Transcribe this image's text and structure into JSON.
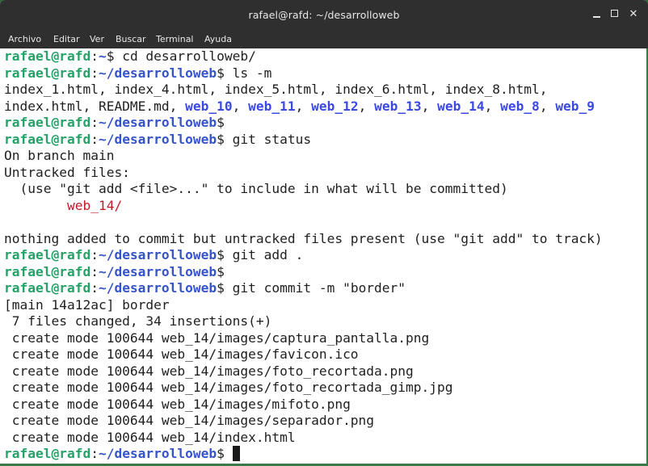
{
  "window": {
    "title": "rafael@rafd: ~/desarrolloweb",
    "controls": {
      "minimize": "minimize-icon",
      "maximize": "maximize-icon",
      "close": "close-icon"
    }
  },
  "menu": [
    "Archivo",
    "Editar",
    "Ver",
    "Buscar",
    "Terminal",
    "Ayuda"
  ],
  "colors": {
    "prompt_user": "#26a269",
    "prompt_path": "#3654c9",
    "directory": "#3b49e0",
    "untracked": "#c01c28",
    "background": "#ffffff",
    "titlebar": "#2f2f2f"
  },
  "terminal": {
    "lines": [
      [
        {
          "t": "rafael@rafd",
          "c": "p-user"
        },
        {
          "t": ":",
          "c": ""
        },
        {
          "t": "~",
          "c": "p-path"
        },
        {
          "t": "$ cd desarrolloweb/",
          "c": ""
        }
      ],
      [
        {
          "t": "rafael@rafd",
          "c": "p-user"
        },
        {
          "t": ":",
          "c": ""
        },
        {
          "t": "~/desarrolloweb",
          "c": "p-path"
        },
        {
          "t": "$ ls -m",
          "c": ""
        }
      ],
      [
        {
          "t": "index_1.html, index_4.html, index_5.html, index_6.html, index_8.html,",
          "c": ""
        }
      ],
      [
        {
          "t": "index.html, README.md, ",
          "c": ""
        },
        {
          "t": "web_10",
          "c": "dir"
        },
        {
          "t": ", ",
          "c": ""
        },
        {
          "t": "web_11",
          "c": "dir"
        },
        {
          "t": ", ",
          "c": ""
        },
        {
          "t": "web_12",
          "c": "dir"
        },
        {
          "t": ", ",
          "c": ""
        },
        {
          "t": "web_13",
          "c": "dir"
        },
        {
          "t": ", ",
          "c": ""
        },
        {
          "t": "web_14",
          "c": "dir"
        },
        {
          "t": ", ",
          "c": ""
        },
        {
          "t": "web_8",
          "c": "dir"
        },
        {
          "t": ", ",
          "c": ""
        },
        {
          "t": "web_9",
          "c": "dir"
        }
      ],
      [
        {
          "t": "rafael@rafd",
          "c": "p-user"
        },
        {
          "t": ":",
          "c": ""
        },
        {
          "t": "~/desarrolloweb",
          "c": "p-path"
        },
        {
          "t": "$",
          "c": ""
        }
      ],
      [
        {
          "t": "rafael@rafd",
          "c": "p-user"
        },
        {
          "t": ":",
          "c": ""
        },
        {
          "t": "~/desarrolloweb",
          "c": "p-path"
        },
        {
          "t": "$ git status",
          "c": ""
        }
      ],
      [
        {
          "t": "On branch main",
          "c": ""
        }
      ],
      [
        {
          "t": "Untracked files:",
          "c": ""
        }
      ],
      [
        {
          "t": "  (use \"git add <file>...\" to include in what will be committed)",
          "c": ""
        }
      ],
      [
        {
          "t": "        ",
          "c": ""
        },
        {
          "t": "web_14/",
          "c": "red"
        }
      ],
      [
        {
          "t": "",
          "c": ""
        }
      ],
      [
        {
          "t": "nothing added to commit but untracked files present (use \"git add\" to track)",
          "c": ""
        }
      ],
      [
        {
          "t": "rafael@rafd",
          "c": "p-user"
        },
        {
          "t": ":",
          "c": ""
        },
        {
          "t": "~/desarrolloweb",
          "c": "p-path"
        },
        {
          "t": "$ git add .",
          "c": ""
        }
      ],
      [
        {
          "t": "rafael@rafd",
          "c": "p-user"
        },
        {
          "t": ":",
          "c": ""
        },
        {
          "t": "~/desarrolloweb",
          "c": "p-path"
        },
        {
          "t": "$",
          "c": ""
        }
      ],
      [
        {
          "t": "rafael@rafd",
          "c": "p-user"
        },
        {
          "t": ":",
          "c": ""
        },
        {
          "t": "~/desarrolloweb",
          "c": "p-path"
        },
        {
          "t": "$ git commit -m \"border\"",
          "c": ""
        }
      ],
      [
        {
          "t": "[main 14a12ac] border",
          "c": ""
        }
      ],
      [
        {
          "t": " 7 files changed, 34 insertions(+)",
          "c": ""
        }
      ],
      [
        {
          "t": " create mode 100644 web_14/images/captura_pantalla.png",
          "c": ""
        }
      ],
      [
        {
          "t": " create mode 100644 web_14/images/favicon.ico",
          "c": ""
        }
      ],
      [
        {
          "t": " create mode 100644 web_14/images/foto_recortada.png",
          "c": ""
        }
      ],
      [
        {
          "t": " create mode 100644 web_14/images/foto_recortada_gimp.jpg",
          "c": ""
        }
      ],
      [
        {
          "t": " create mode 100644 web_14/images/mifoto.png",
          "c": ""
        }
      ],
      [
        {
          "t": " create mode 100644 web_14/images/separador.png",
          "c": ""
        }
      ],
      [
        {
          "t": " create mode 100644 web_14/index.html",
          "c": ""
        }
      ],
      [
        {
          "t": "rafael@rafd",
          "c": "p-user"
        },
        {
          "t": ":",
          "c": ""
        },
        {
          "t": "~/desarrolloweb",
          "c": "p-path"
        },
        {
          "t": "$ ",
          "c": ""
        }
      ]
    ]
  }
}
